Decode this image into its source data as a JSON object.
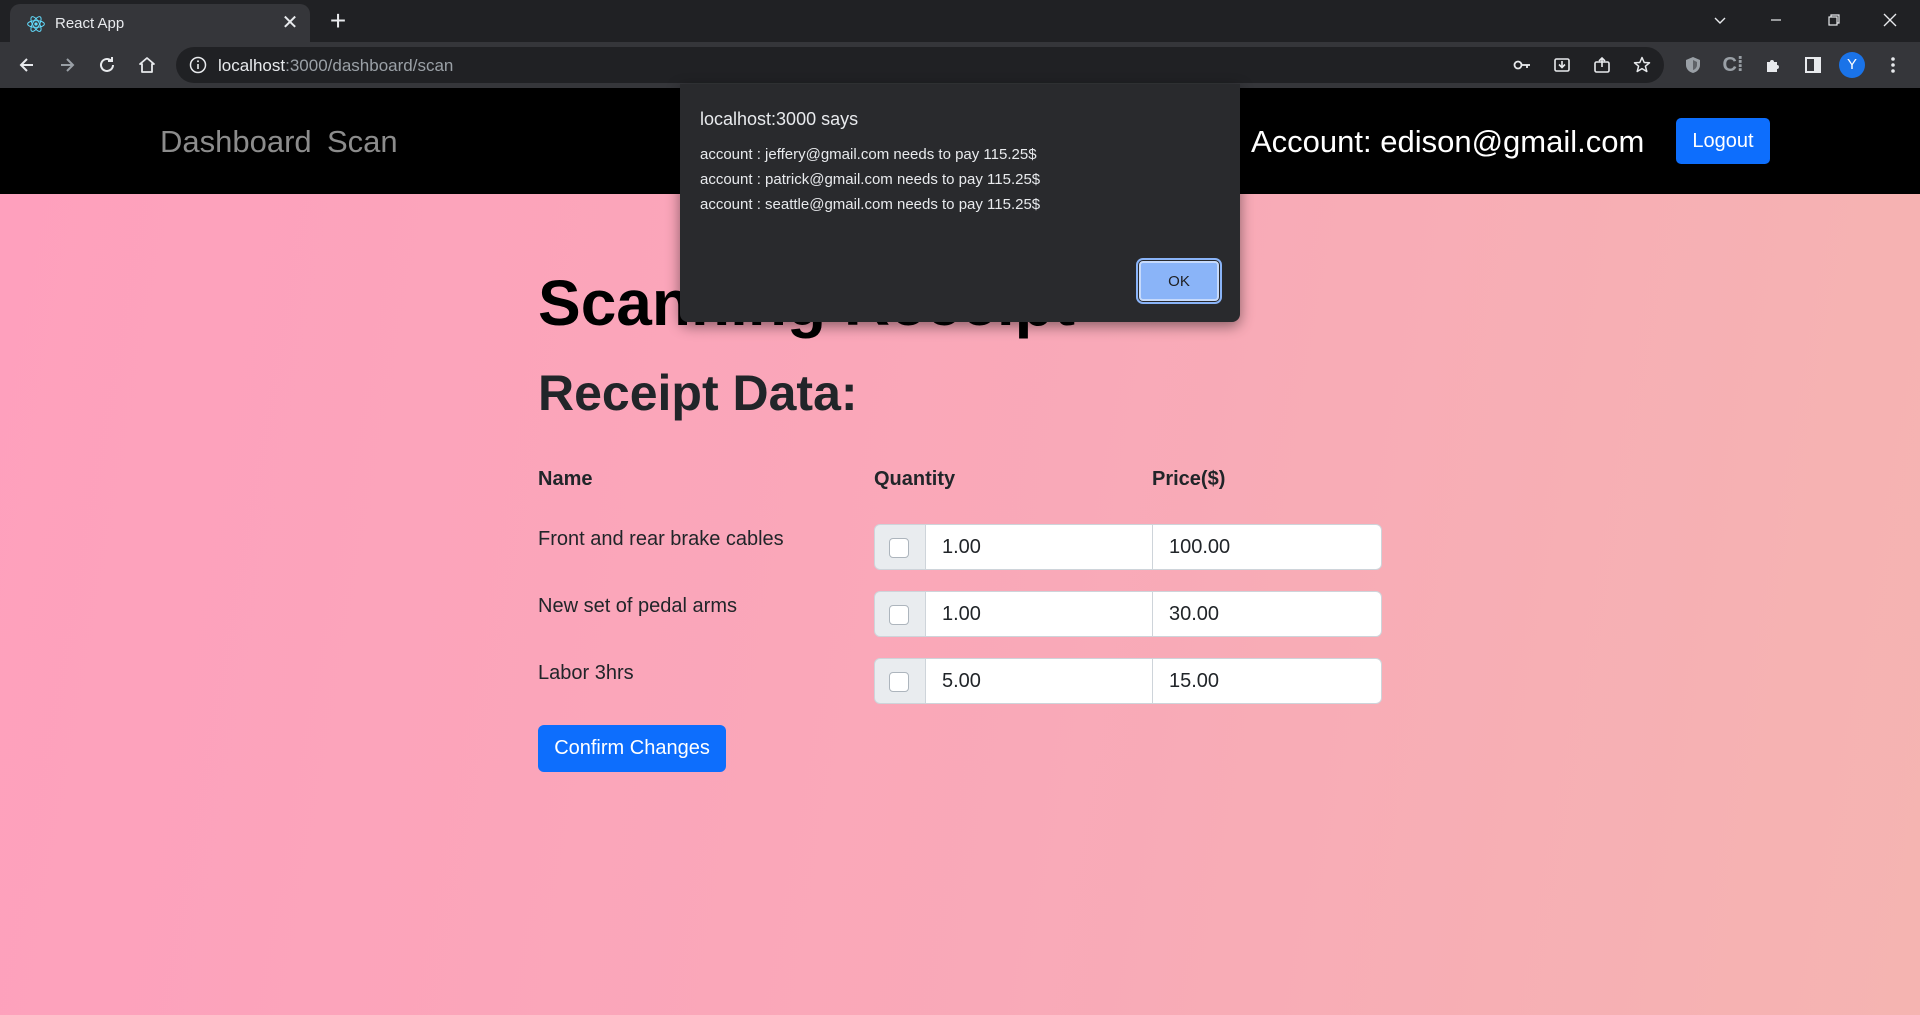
{
  "browser": {
    "tab_title": "React App",
    "url_host": "localhost",
    "url_rest": ":3000/dashboard/scan",
    "profile_initial": "Y",
    "colors": {
      "frame": "#202124",
      "toolbar": "#35363a",
      "profile": "#1a73e8"
    }
  },
  "navbar": {
    "links": [
      "Dashboard",
      "Scan"
    ],
    "account": "Account: edison@gmail.com",
    "logout_label": "Logout"
  },
  "main": {
    "title": "Scanning Receipt",
    "section_title": "Receipt Data:",
    "columns": {
      "name": "Name",
      "quantity": "Quantity",
      "price": "Price($)"
    },
    "items": [
      {
        "name": "Front and rear brake cables",
        "quantity": "1.00",
        "price": "100.00",
        "checked": false
      },
      {
        "name": "New set of pedal arms",
        "quantity": "1.00",
        "price": "30.00",
        "checked": false
      },
      {
        "name": "Labor 3hrs",
        "quantity": "5.00",
        "price": "15.00",
        "checked": false
      }
    ],
    "confirm_label": "Confirm Changes",
    "colors": {
      "primary": "#0d6efd",
      "background_start": "#fea0bd",
      "background_end": "#f5b4b1"
    }
  },
  "dialog": {
    "title": "localhost:3000 says",
    "lines": [
      "account : jeffery@gmail.com needs to pay 115.25$",
      "account : patrick@gmail.com needs to pay 115.25$",
      "account : seattle@gmail.com needs to pay 115.25$"
    ],
    "ok_label": "OK"
  }
}
